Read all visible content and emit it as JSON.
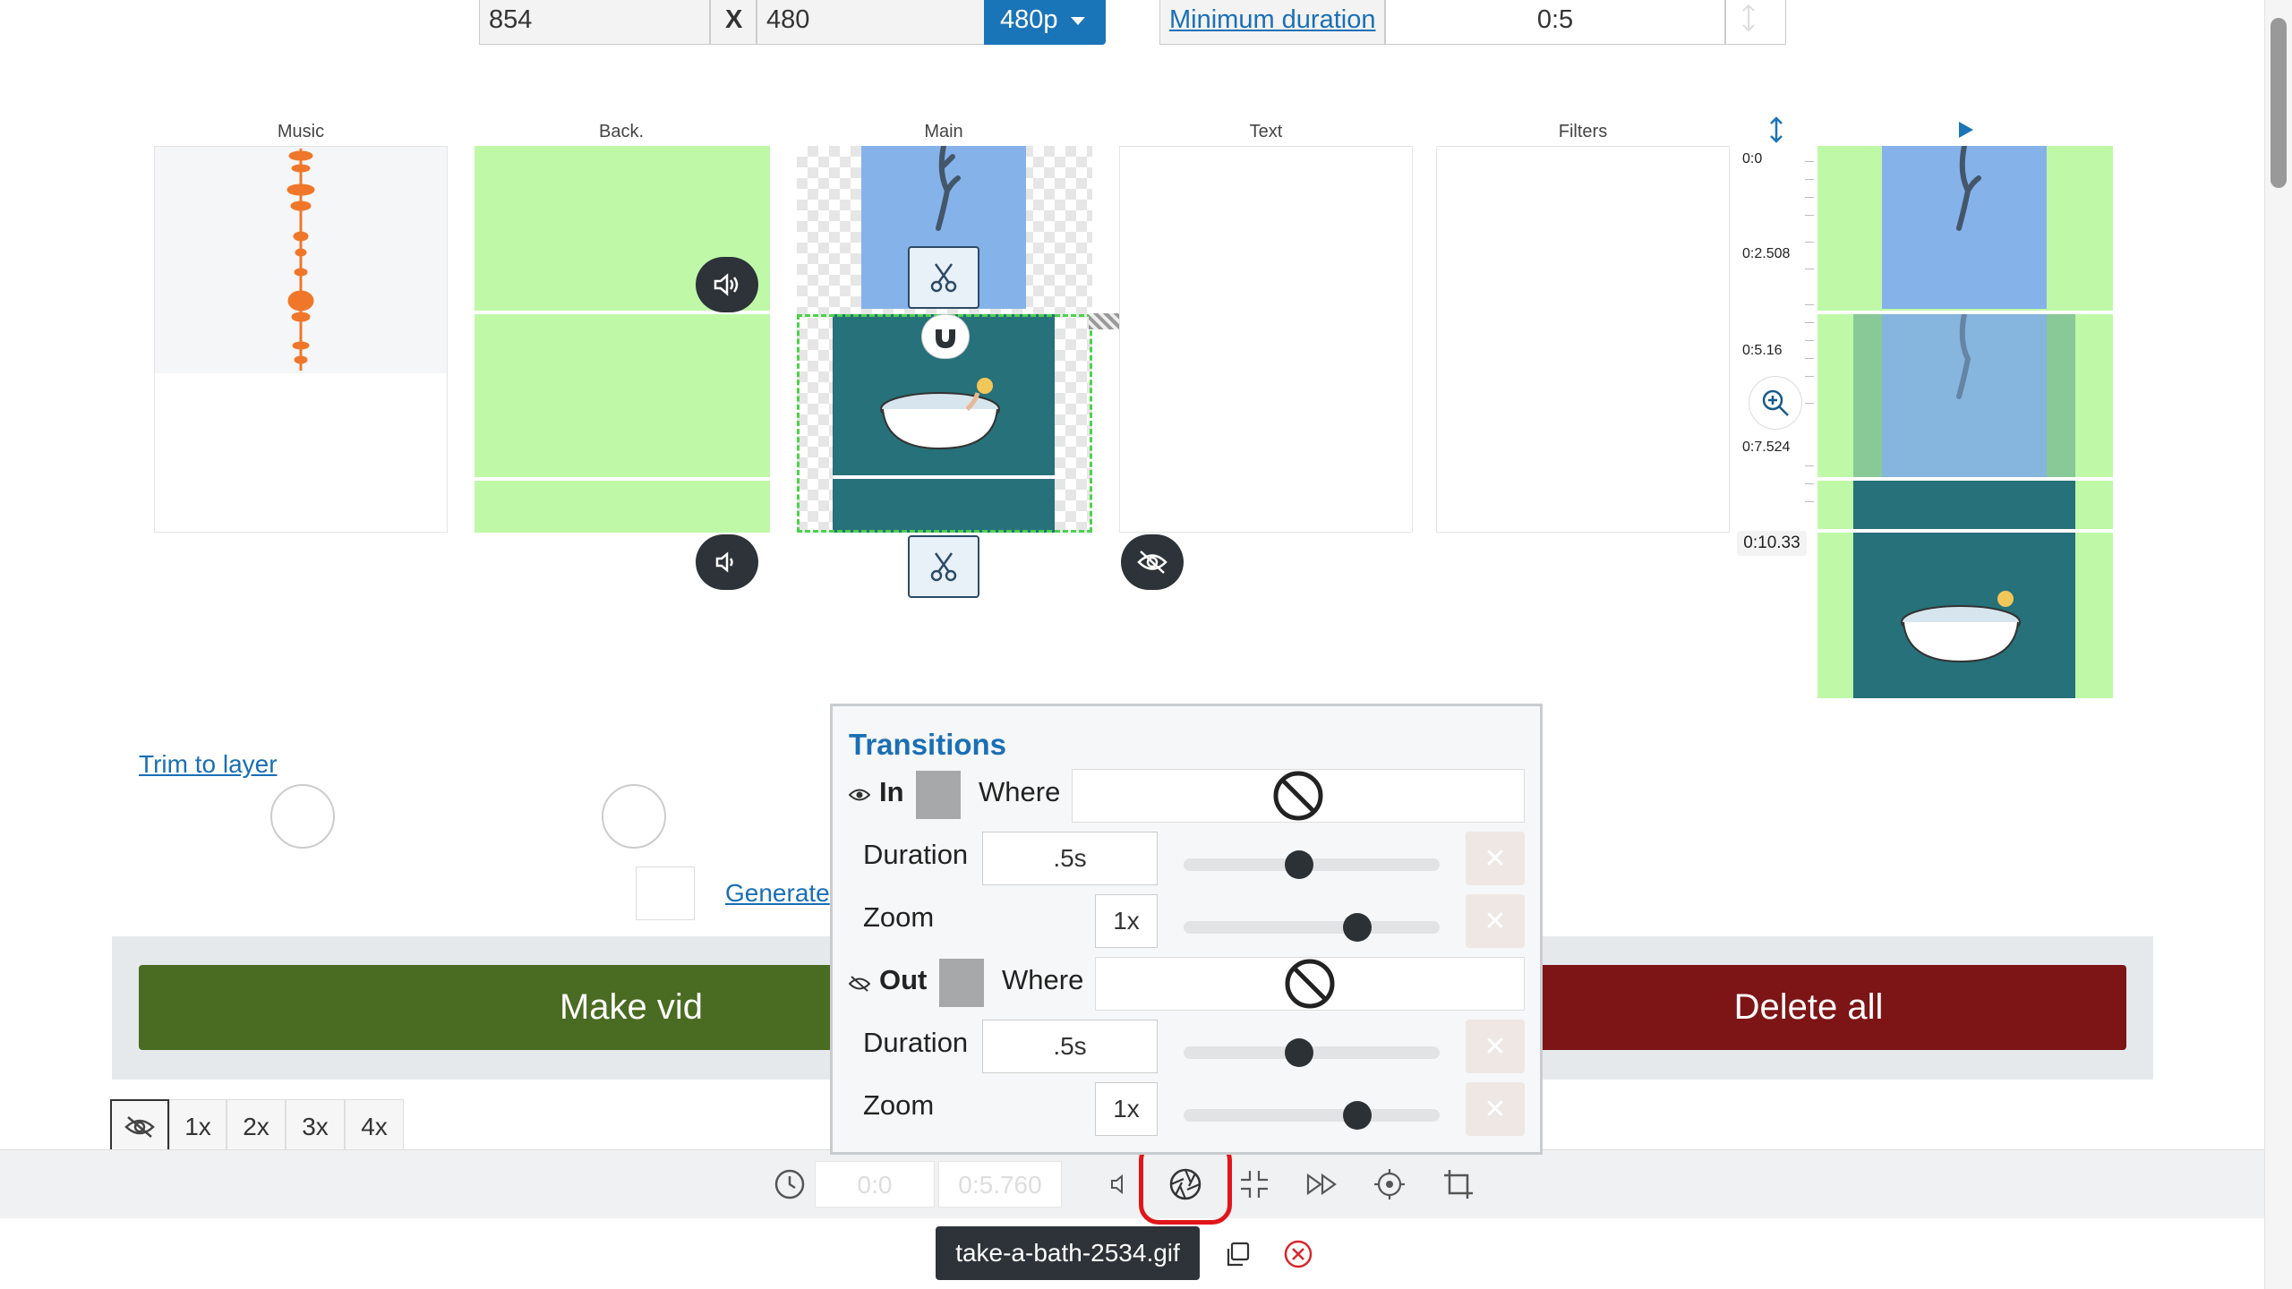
{
  "output": {
    "width_value": "854",
    "x_label": "X",
    "height_value": "480",
    "resolution_label": "480p",
    "min_duration_label": "Minimum duration",
    "min_duration_value": "0:5"
  },
  "lanes": {
    "music": "Music",
    "back": "Back.",
    "main": "Main",
    "text": "Text",
    "filters": "Filters"
  },
  "timeline": {
    "ticks": [
      "0:0",
      "0:2.508",
      "0:5.16",
      "0:7.524",
      "0:10.33"
    ]
  },
  "links": {
    "trim_to_layer": "Trim to layer",
    "generate": "Generate"
  },
  "actions": {
    "make_video": "Make vid",
    "delete_all": "Delete all"
  },
  "zoom_buttons": [
    "1x",
    "2x",
    "3x",
    "4x"
  ],
  "player": {
    "start_time": "0:0",
    "end_time": "0:5.760"
  },
  "file": {
    "name": "take-a-bath-2534.gif"
  },
  "transitions": {
    "title": "Transitions",
    "in": {
      "label": "In",
      "where_label": "Where",
      "duration_label": "Duration",
      "duration_value": ".5s",
      "duration_level": 0.46,
      "zoom_label": "Zoom",
      "zoom_value": "1x",
      "zoom_level": 0.68
    },
    "out": {
      "label": "Out",
      "where_label": "Where",
      "duration_label": "Duration",
      "duration_value": ".5s",
      "duration_level": 0.46,
      "zoom_label": "Zoom",
      "zoom_value": "1x",
      "zoom_level": 0.68
    }
  },
  "colors": {
    "primary_blue": "#1a74b8",
    "make_green": "#4a6b22",
    "delete_red": "#7d1416",
    "lane_green": "#bff9a8",
    "clip_teal": "#26717a",
    "clip_blue": "#86b2ea",
    "music_orange": "#f0772a",
    "highlight_red": "#e0161b"
  }
}
